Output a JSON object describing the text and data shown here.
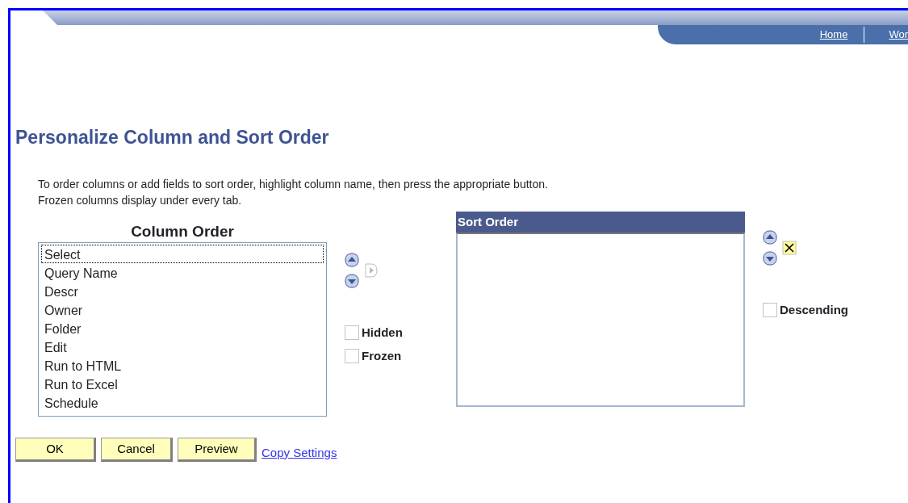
{
  "header": {
    "links": [
      "Home",
      "Wor"
    ]
  },
  "title": "Personalize Column and Sort Order",
  "instructions": [
    "To order columns or add fields to sort order, highlight column name, then press the appropriate button.",
    "Frozen columns display under every tab."
  ],
  "column_order": {
    "heading": "Column Order",
    "items": [
      {
        "label": "Select",
        "focused": true
      },
      {
        "label": "Query Name",
        "focused": false
      },
      {
        "label": "Descr",
        "focused": false
      },
      {
        "label": "Owner",
        "focused": false
      },
      {
        "label": "Folder",
        "focused": false
      },
      {
        "label": "Edit",
        "focused": false
      },
      {
        "label": "Run to HTML",
        "focused": false
      },
      {
        "label": "Run to Excel",
        "focused": false
      },
      {
        "label": "Schedule",
        "focused": false
      }
    ],
    "add_disabled": true,
    "checkboxes": [
      {
        "label": "Hidden",
        "checked": false
      },
      {
        "label": "Frozen",
        "checked": false
      }
    ]
  },
  "sort_order": {
    "heading": "Sort Order",
    "checkboxes": [
      {
        "label": "Descending",
        "checked": false
      }
    ]
  },
  "buttons": [
    "OK",
    "Cancel",
    "Preview"
  ],
  "link": "Copy Settings"
}
